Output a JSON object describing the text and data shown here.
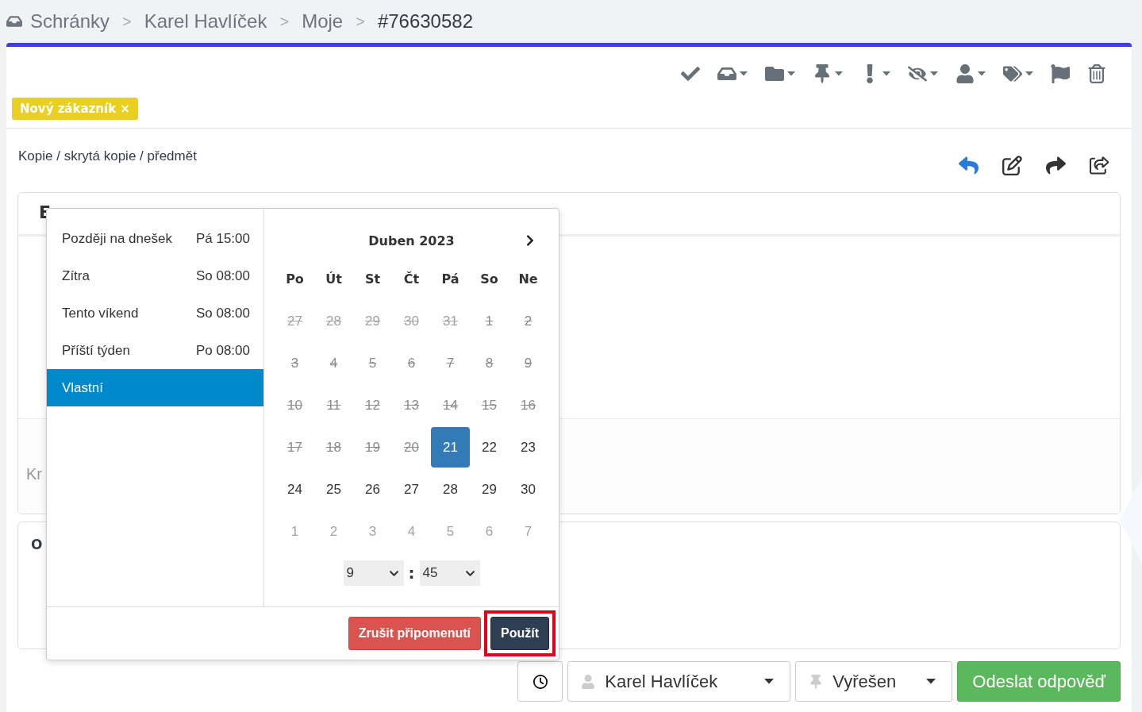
{
  "breadcrumb": [
    {
      "label": "Schránky",
      "current": false
    },
    {
      "label": "Karel Havlíček",
      "current": false
    },
    {
      "label": "Moje",
      "current": false
    },
    {
      "label": "#76630582",
      "current": true
    }
  ],
  "breadcrumb_separator": ">",
  "toolbar": [
    {
      "dropdown": false
    },
    {
      "dropdown": true
    },
    {
      "dropdown": true
    },
    {
      "dropdown": true
    },
    {
      "dropdown": true
    },
    {
      "dropdown": true
    },
    {
      "dropdown": true
    },
    {
      "dropdown": true
    },
    {
      "dropdown": false
    },
    {
      "dropdown": false
    }
  ],
  "tags": [
    {
      "label": "Nový zákazník",
      "remove": "×",
      "color": "#e8d01c"
    }
  ],
  "recipients_toggle": "Kopie / skrytá kopie / předmět",
  "message_actions": [
    {
      "highlighted": true
    },
    {
      "highlighted": false
    },
    {
      "highlighted": false
    },
    {
      "highlighted": false
    }
  ],
  "editor": {
    "header": "E",
    "footer_text": "Kr"
  },
  "notes": {
    "header": "O"
  },
  "reminder": {
    "presets": [
      {
        "label": "Později na dnešek",
        "time": "Pá 15:00",
        "selected": false
      },
      {
        "label": "Zítra",
        "time": "So 08:00",
        "selected": false
      },
      {
        "label": "Tento víkend",
        "time": "So 08:00",
        "selected": false
      },
      {
        "label": "Příští týden",
        "time": "Po 08:00",
        "selected": false
      },
      {
        "label": "Vlastní",
        "selected": true
      }
    ],
    "month": "Duben 2023",
    "weekdays": [
      "Po",
      "Út",
      "St",
      "Čt",
      "Pá",
      "So",
      "Ne"
    ],
    "weeks": [
      [
        {
          "label": "27",
          "disabled": true,
          "outside": true,
          "selected": false
        },
        {
          "label": "28",
          "disabled": true,
          "outside": true,
          "selected": false
        },
        {
          "label": "29",
          "disabled": true,
          "outside": true,
          "selected": false
        },
        {
          "label": "30",
          "disabled": true,
          "outside": true,
          "selected": false
        },
        {
          "label": "31",
          "disabled": true,
          "outside": true,
          "selected": false
        },
        {
          "label": "1",
          "disabled": true,
          "outside": false,
          "selected": false
        },
        {
          "label": "2",
          "disabled": true,
          "outside": false,
          "selected": false
        }
      ],
      [
        {
          "label": "3",
          "disabled": true,
          "outside": false,
          "selected": false
        },
        {
          "label": "4",
          "disabled": true,
          "outside": false,
          "selected": false
        },
        {
          "label": "5",
          "disabled": true,
          "outside": false,
          "selected": false
        },
        {
          "label": "6",
          "disabled": true,
          "outside": false,
          "selected": false
        },
        {
          "label": "7",
          "disabled": true,
          "outside": false,
          "selected": false
        },
        {
          "label": "8",
          "disabled": true,
          "outside": false,
          "selected": false
        },
        {
          "label": "9",
          "disabled": true,
          "outside": false,
          "selected": false
        }
      ],
      [
        {
          "label": "10",
          "disabled": true,
          "outside": false,
          "selected": false
        },
        {
          "label": "11",
          "disabled": true,
          "outside": false,
          "selected": false
        },
        {
          "label": "12",
          "disabled": true,
          "outside": false,
          "selected": false
        },
        {
          "label": "13",
          "disabled": true,
          "outside": false,
          "selected": false
        },
        {
          "label": "14",
          "disabled": true,
          "outside": false,
          "selected": false
        },
        {
          "label": "15",
          "disabled": true,
          "outside": false,
          "selected": false
        },
        {
          "label": "16",
          "disabled": true,
          "outside": false,
          "selected": false
        }
      ],
      [
        {
          "label": "17",
          "disabled": true,
          "outside": false,
          "selected": false
        },
        {
          "label": "18",
          "disabled": true,
          "outside": false,
          "selected": false
        },
        {
          "label": "19",
          "disabled": true,
          "outside": false,
          "selected": false
        },
        {
          "label": "20",
          "disabled": true,
          "outside": false,
          "selected": false
        },
        {
          "label": "21",
          "disabled": false,
          "outside": false,
          "selected": true
        },
        {
          "label": "22",
          "disabled": false,
          "outside": false,
          "selected": false
        },
        {
          "label": "23",
          "disabled": false,
          "outside": false,
          "selected": false
        }
      ],
      [
        {
          "label": "24",
          "disabled": false,
          "outside": false,
          "selected": false
        },
        {
          "label": "25",
          "disabled": false,
          "outside": false,
          "selected": false
        },
        {
          "label": "26",
          "disabled": false,
          "outside": false,
          "selected": false
        },
        {
          "label": "27",
          "disabled": false,
          "outside": false,
          "selected": false
        },
        {
          "label": "28",
          "disabled": false,
          "outside": false,
          "selected": false
        },
        {
          "label": "29",
          "disabled": false,
          "outside": false,
          "selected": false
        },
        {
          "label": "30",
          "disabled": false,
          "outside": false,
          "selected": false
        }
      ],
      [
        {
          "label": "1",
          "disabled": false,
          "outside": true,
          "selected": false
        },
        {
          "label": "2",
          "disabled": false,
          "outside": true,
          "selected": false
        },
        {
          "label": "3",
          "disabled": false,
          "outside": true,
          "selected": false
        },
        {
          "label": "4",
          "disabled": false,
          "outside": true,
          "selected": false
        },
        {
          "label": "5",
          "disabled": false,
          "outside": true,
          "selected": false
        },
        {
          "label": "6",
          "disabled": false,
          "outside": true,
          "selected": false
        },
        {
          "label": "7",
          "disabled": false,
          "outside": true,
          "selected": false
        }
      ]
    ],
    "hour": "9",
    "time_separator": ":",
    "minute": "45",
    "cancel_button": "Zrušit připomenutí",
    "apply_button": {
      "label": "Použít",
      "highlighted": true
    }
  },
  "footer": {
    "assignee": "Karel Havlíček",
    "status": "Vyřešen",
    "send_button": "Odeslat odpověď"
  }
}
